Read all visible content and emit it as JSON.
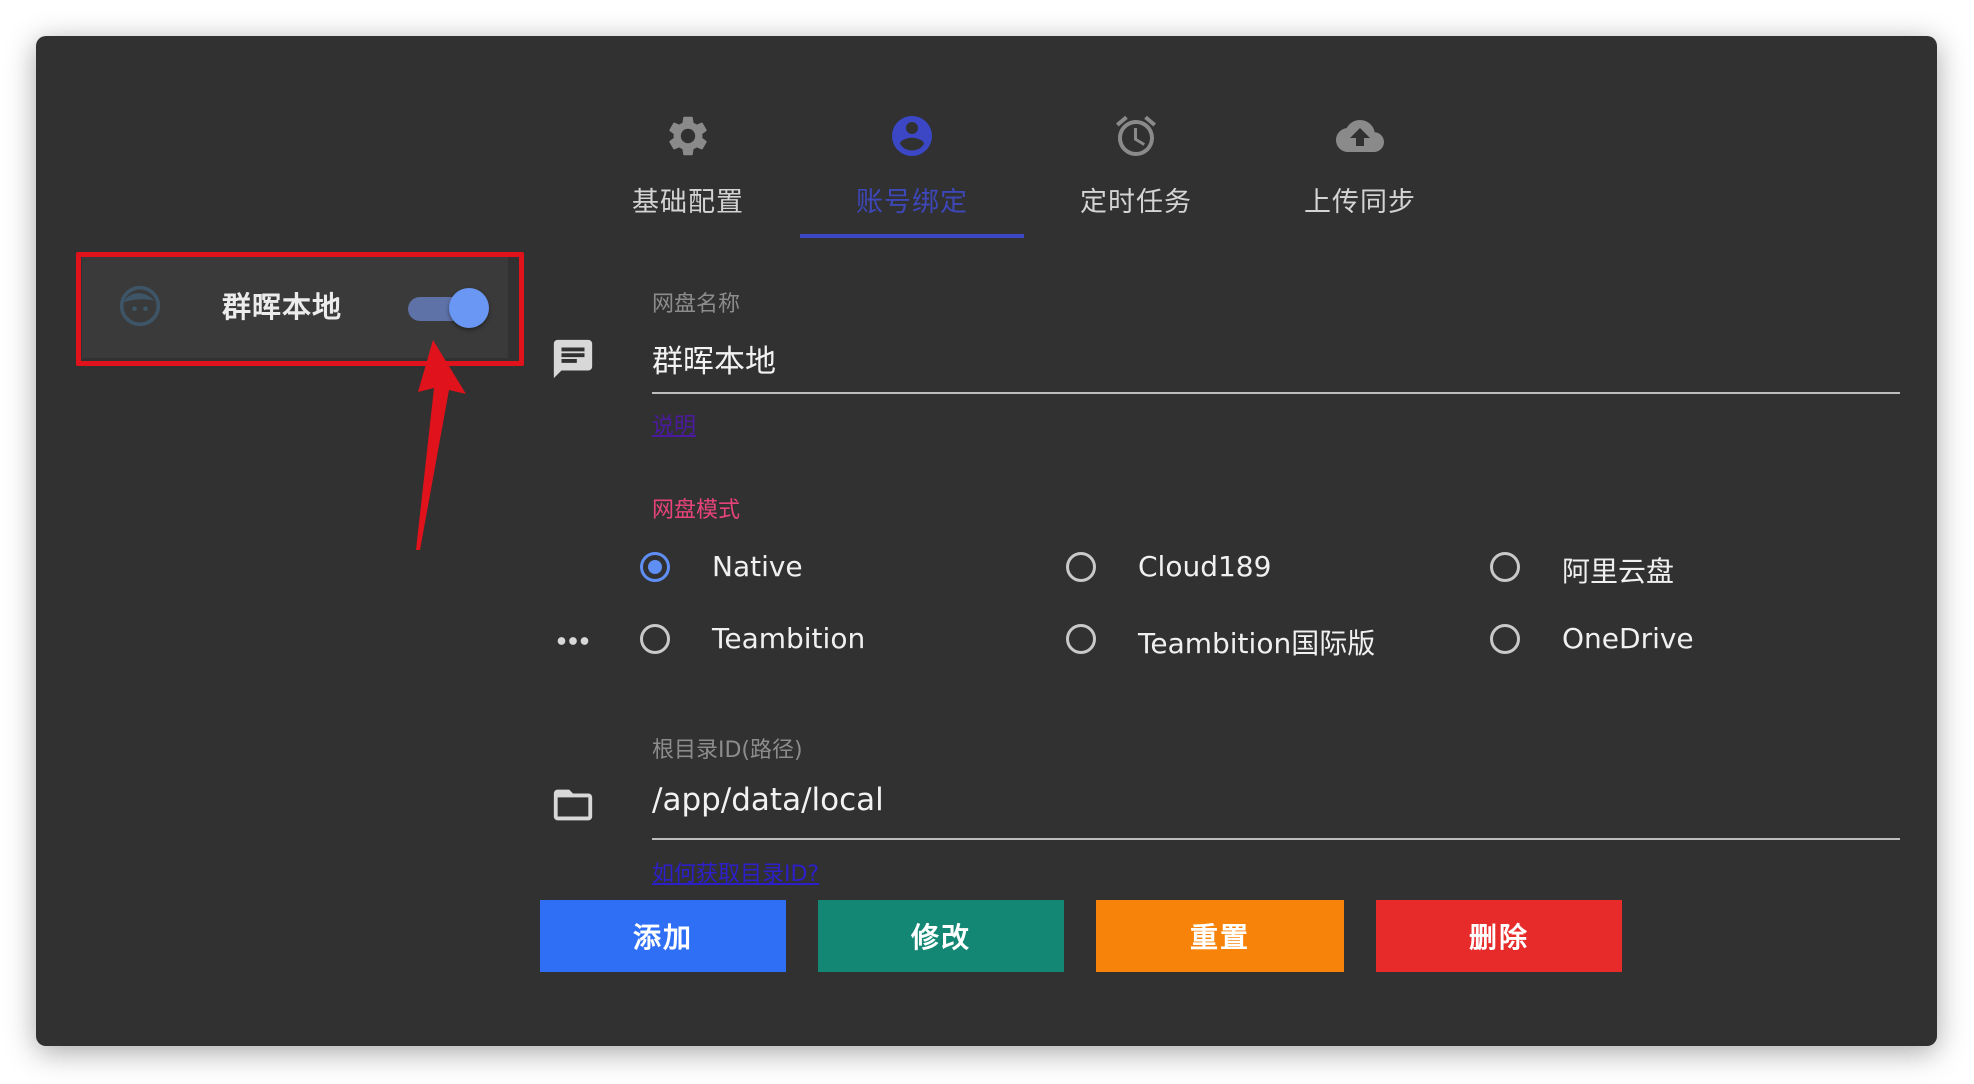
{
  "tabs": [
    {
      "label": "基础配置",
      "icon": "gear-icon"
    },
    {
      "label": "账号绑定",
      "icon": "account-circle-icon",
      "active": true
    },
    {
      "label": "定时任务",
      "icon": "alarm-icon"
    },
    {
      "label": "上传同步",
      "icon": "cloud-upload-icon"
    }
  ],
  "sidebar": {
    "items": [
      {
        "name": "群晖本地",
        "enabled": true,
        "icon": "face-icon"
      }
    ]
  },
  "form": {
    "drive_name": {
      "label": "网盘名称",
      "value": "群晖本地",
      "hint": "说明",
      "icon": "comment-icon"
    },
    "mode": {
      "label": "网盘模式",
      "icon": "more-horiz-icon",
      "options": [
        "Native",
        "Cloud189",
        "阿里云盘",
        "Teambition",
        "Teambition国际版",
        "OneDrive"
      ],
      "selected": "Native"
    },
    "root": {
      "label": "根目录ID(路径)",
      "value": "/app/data/local",
      "hint": "如何获取目录ID?",
      "icon": "folder-icon"
    }
  },
  "buttons": {
    "add": "添加",
    "modify": "修改",
    "reset": "重置",
    "delete": "删除"
  },
  "colors": {
    "panel_bg": "#313131",
    "accent": "#3b47c4",
    "add": "#2f6ff5",
    "modify": "#138774",
    "reset": "#f8830a",
    "delete": "#e72b2a",
    "annotation": "#e0121b"
  }
}
